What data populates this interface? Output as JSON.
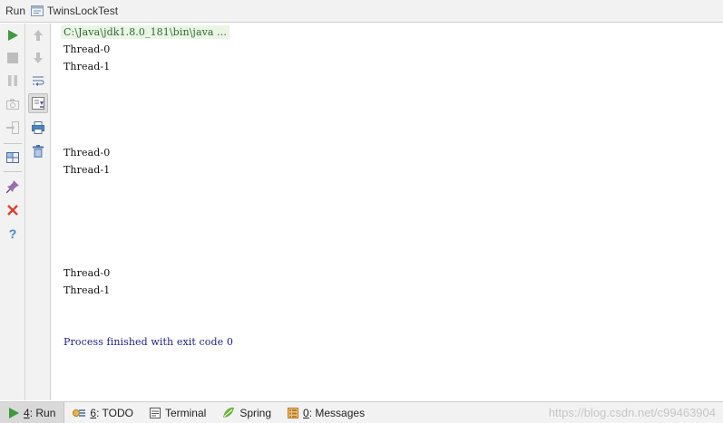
{
  "titlebar": {
    "panel_label": "Run",
    "config_name": "TwinsLockTest"
  },
  "console": {
    "command": "C:\\Java\\jdk1.8.0_181\\bin\\java ...",
    "lines": [
      "Thread-0",
      "Thread-1",
      "Thread-0",
      "Thread-1",
      "Thread-0",
      "Thread-1"
    ],
    "exit_message": "Process finished with exit code 0"
  },
  "toolbar_left": {
    "icons": [
      "run-icon",
      "stop-icon",
      "pause-icon",
      "camera-icon",
      "exit-icon",
      "layout-icon",
      "pin-icon",
      "close-icon",
      "help-icon"
    ]
  },
  "toolbar_right": {
    "icons": [
      "up-icon",
      "down-icon",
      "soft-wrap-icon",
      "scroll-to-end-icon",
      "print-icon",
      "trash-icon"
    ]
  },
  "bottom_tabs": [
    {
      "mnemonic": "4",
      "label": ": Run",
      "icon": "run-icon",
      "active": true
    },
    {
      "mnemonic": "6",
      "label": ": TODO",
      "icon": "todo-icon",
      "active": false
    },
    {
      "mnemonic": "",
      "label": "Terminal",
      "icon": "terminal-icon",
      "active": false
    },
    {
      "mnemonic": "",
      "label": "Spring",
      "icon": "spring-icon",
      "active": false
    },
    {
      "mnemonic": "0",
      "label": ": Messages",
      "icon": "messages-icon",
      "active": false
    }
  ],
  "watermark": "https://blog.csdn.net/c99463904",
  "colors": {
    "run_green": "#3a9c3a",
    "close_red": "#d8442b",
    "help_blue": "#3a86d0",
    "exit_text": "#1b1b8c"
  }
}
